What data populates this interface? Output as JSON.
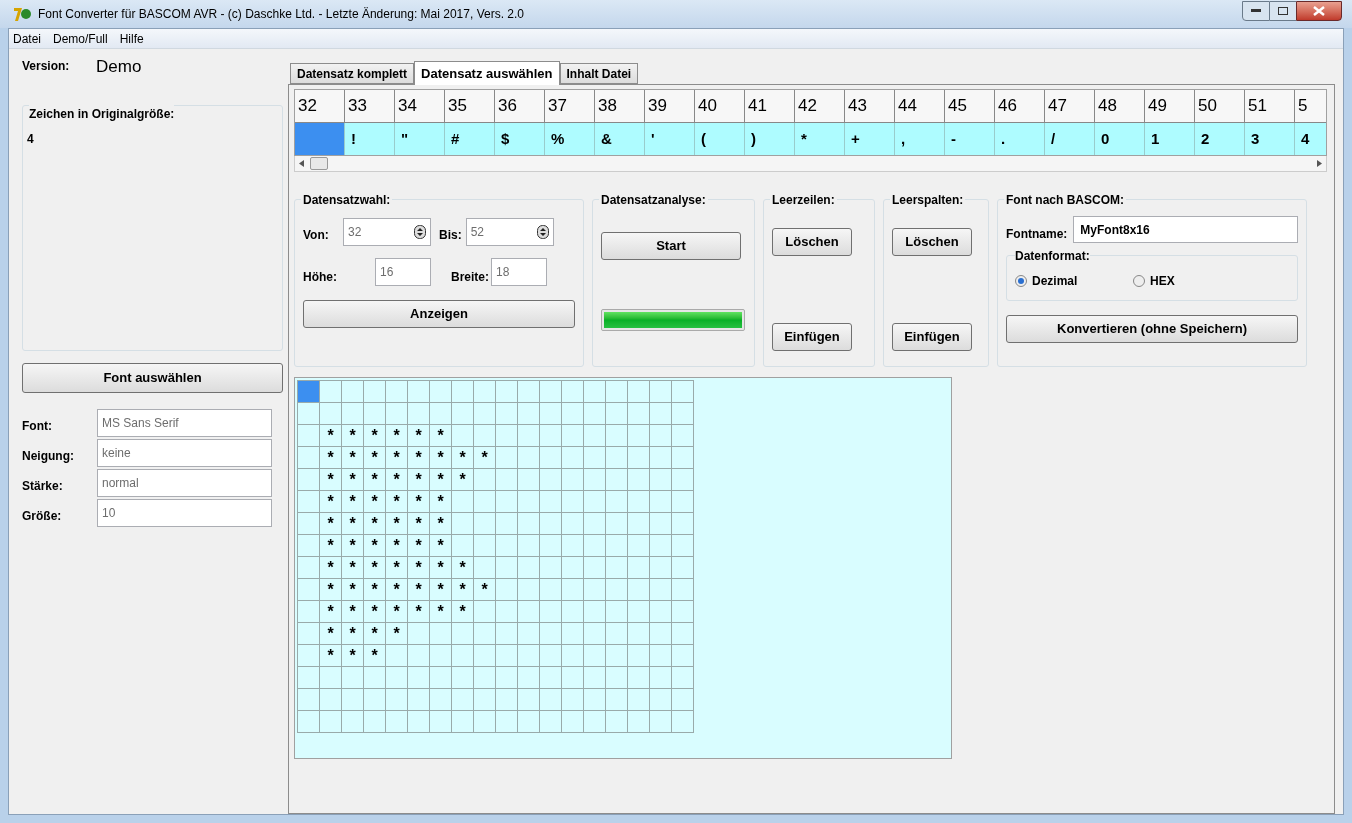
{
  "window": {
    "title": "Font Converter für BASCOM AVR - (c) Daschke Ltd. - Letzte Änderung: Mai 2017, Vers. 2.0"
  },
  "menu": [
    "Datei",
    "Demo/Full",
    "Hilfe"
  ],
  "left": {
    "version_label": "Version:",
    "version_value": "Demo",
    "original_group": "Zeichen in Originalgröße:",
    "original_value": "4",
    "font_button": "Font auswählen",
    "fields": [
      {
        "label": "Font:",
        "value": "MS Sans Serif"
      },
      {
        "label": "Neigung:",
        "value": "keine"
      },
      {
        "label": "Stärke:",
        "value": "normal"
      },
      {
        "label": "Größe:",
        "value": "10"
      }
    ]
  },
  "tabs": [
    {
      "label": "Datensatz komplett",
      "selected": false
    },
    {
      "label": "Datensatz auswählen",
      "selected": true
    },
    {
      "label": "Inhalt Datei",
      "selected": false
    }
  ],
  "char_table": [
    {
      "code": "32",
      "selected": true
    },
    {
      "code": "33",
      "char": "!",
      "selected": false
    },
    {
      "code": "34",
      "char": "\"",
      "selected": false
    },
    {
      "code": "35",
      "char": "#",
      "selected": false
    },
    {
      "code": "36",
      "char": "$",
      "selected": false
    },
    {
      "code": "37",
      "char": "%",
      "selected": false
    },
    {
      "code": "38",
      "char": "&",
      "selected": false
    },
    {
      "code": "39",
      "char": "'",
      "selected": false
    },
    {
      "code": "40",
      "char": "(",
      "selected": false
    },
    {
      "code": "41",
      "char": ")",
      "selected": false
    },
    {
      "code": "42",
      "char": "*",
      "selected": false
    },
    {
      "code": "43",
      "char": "+",
      "selected": false
    },
    {
      "code": "44",
      "char": ",",
      "selected": false
    },
    {
      "code": "45",
      "char": "-",
      "selected": false
    },
    {
      "code": "46",
      "char": ".",
      "selected": false
    },
    {
      "code": "47",
      "char": "/",
      "selected": false
    },
    {
      "code": "48",
      "char": "0",
      "selected": false
    },
    {
      "code": "49",
      "char": "1",
      "selected": false
    },
    {
      "code": "50",
      "char": "2",
      "selected": false
    },
    {
      "code": "51",
      "char": "3",
      "selected": false
    },
    {
      "code": "5",
      "char": "4",
      "selected": false
    }
  ],
  "datensatzwahl": {
    "title": "Datensatzwahl:",
    "von_label": "Von:",
    "von_value": "32",
    "bis_label": "Bis:",
    "bis_value": "52",
    "hoehe_label": "Höhe:",
    "hoehe_value": "16",
    "breite_label": "Breite:",
    "breite_value": "18",
    "button": "Anzeigen"
  },
  "analyse": {
    "title": "Datensatzanalyse:",
    "button": "Start",
    "level": 1
  },
  "leerzeilen": {
    "title": "Leerzeilen:",
    "delete": "Löschen",
    "insert": "Einfügen"
  },
  "leerspalten": {
    "title": "Leerspalten:",
    "delete": "Löschen",
    "insert": "Einfügen"
  },
  "bascom": {
    "title": "Font nach BASCOM:",
    "fontname_label": "Fontname:",
    "fontname_value": "MyFont8x16",
    "format_title": "Datenformat:",
    "formats": [
      {
        "label": "Dezimal",
        "selected": true
      },
      {
        "label": "HEX",
        "selected": false
      }
    ],
    "button": "Konvertieren (ohne Speichern)"
  },
  "grid": {
    "cursor_cell": true,
    "rows": [
      [
        null,
        null,
        null,
        null,
        null,
        null,
        null,
        null,
        null,
        null,
        null,
        null,
        null,
        null,
        null,
        null,
        null,
        null
      ],
      [
        null,
        null,
        null,
        null,
        null,
        null,
        null,
        null,
        null,
        null,
        null,
        null,
        null,
        null,
        null,
        null,
        null,
        null
      ],
      [
        null,
        "*",
        "*",
        "*",
        "*",
        "*",
        "*",
        null,
        null,
        null,
        null,
        null,
        null,
        null,
        null,
        null,
        null,
        null
      ],
      [
        null,
        "*",
        "*",
        "*",
        "*",
        "*",
        "*",
        "*",
        "*",
        null,
        null,
        null,
        null,
        null,
        null,
        null,
        null,
        null
      ],
      [
        null,
        "*",
        "*",
        "*",
        "*",
        "*",
        "*",
        "*",
        null,
        null,
        null,
        null,
        null,
        null,
        null,
        null,
        null,
        null
      ],
      [
        null,
        "*",
        "*",
        "*",
        "*",
        "*",
        "*",
        null,
        null,
        null,
        null,
        null,
        null,
        null,
        null,
        null,
        null,
        null
      ],
      [
        null,
        "*",
        "*",
        "*",
        "*",
        "*",
        "*",
        null,
        null,
        null,
        null,
        null,
        null,
        null,
        null,
        null,
        null,
        null
      ],
      [
        null,
        "*",
        "*",
        "*",
        "*",
        "*",
        "*",
        null,
        null,
        null,
        null,
        null,
        null,
        null,
        null,
        null,
        null,
        null
      ],
      [
        null,
        "*",
        "*",
        "*",
        "*",
        "*",
        "*",
        "*",
        null,
        null,
        null,
        null,
        null,
        null,
        null,
        null,
        null,
        null
      ],
      [
        null,
        "*",
        "*",
        "*",
        "*",
        "*",
        "*",
        "*",
        "*",
        null,
        null,
        null,
        null,
        null,
        null,
        null,
        null,
        null
      ],
      [
        null,
        "*",
        "*",
        "*",
        "*",
        "*",
        "*",
        "*",
        null,
        null,
        null,
        null,
        null,
        null,
        null,
        null,
        null,
        null
      ],
      [
        null,
        "*",
        "*",
        "*",
        "*",
        null,
        null,
        null,
        null,
        null,
        null,
        null,
        null,
        null,
        null,
        null,
        null,
        null
      ],
      [
        null,
        "*",
        "*",
        "*",
        null,
        null,
        null,
        null,
        null,
        null,
        null,
        null,
        null,
        null,
        null,
        null,
        null,
        null
      ],
      [
        null,
        null,
        null,
        null,
        null,
        null,
        null,
        null,
        null,
        null,
        null,
        null,
        null,
        null,
        null,
        null,
        null,
        null
      ],
      [
        null,
        null,
        null,
        null,
        null,
        null,
        null,
        null,
        null,
        null,
        null,
        null,
        null,
        null,
        null,
        null,
        null,
        null
      ],
      [
        null,
        null,
        null,
        null,
        null,
        null,
        null,
        null,
        null,
        null,
        null,
        null,
        null,
        null,
        null,
        null,
        null,
        null
      ]
    ]
  }
}
